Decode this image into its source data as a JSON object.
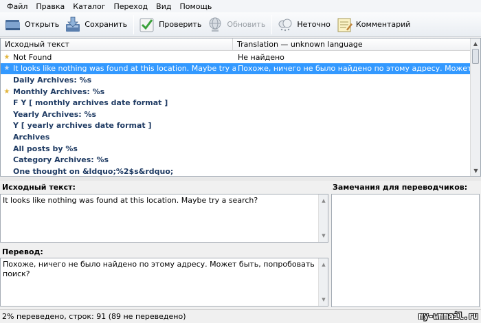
{
  "menu": [
    "Файл",
    "Правка",
    "Каталог",
    "Переход",
    "Вид",
    "Помощь"
  ],
  "toolbar": {
    "open": "Открыть",
    "save": "Сохранить",
    "validate": "Проверить",
    "update": "Обновить",
    "fuzzy": "Неточно",
    "comment": "Комментарий"
  },
  "list": {
    "col_source": "Исходный текст",
    "col_translation": "Translation — unknown language",
    "rows": [
      {
        "source": "Not Found",
        "translation": "Не найдено",
        "mark": "★",
        "state": "translated"
      },
      {
        "source": "It looks like nothing was found at this location. Maybe try a search?",
        "translation": "Похоже, ничего не было найдено по этому адресу. Может быть, п...",
        "mark": "★",
        "state": "selected"
      },
      {
        "source": "Daily Archives: %s",
        "translation": "",
        "mark": "",
        "state": "untranslated"
      },
      {
        "source": "Monthly Archives: %s",
        "translation": "",
        "mark": "★",
        "state": "untranslated"
      },
      {
        "source": "F Y  [ monthly archives date format ]",
        "translation": "",
        "mark": "",
        "state": "untranslated"
      },
      {
        "source": "Yearly Archives: %s",
        "translation": "",
        "mark": "",
        "state": "untranslated"
      },
      {
        "source": "Y  [ yearly archives date format ]",
        "translation": "",
        "mark": "",
        "state": "untranslated"
      },
      {
        "source": "Archives",
        "translation": "",
        "mark": "",
        "state": "untranslated"
      },
      {
        "source": "All posts by %s",
        "translation": "",
        "mark": "",
        "state": "untranslated"
      },
      {
        "source": "Category Archives: %s",
        "translation": "",
        "mark": "",
        "state": "untranslated"
      },
      {
        "source": "One thought on &ldquo;%2$s&rdquo;",
        "translation": "",
        "mark": "",
        "state": "untranslated"
      }
    ]
  },
  "editor": {
    "source_label": "Исходный текст:",
    "source_text": "It looks like nothing was found at this location. Maybe try a search?",
    "translation_label": "Перевод:",
    "translation_text": "Похоже, ничего не было найдено по этому адресу. Может быть, попробовать поиск?",
    "notes_label": "Замечания для переводчиков:"
  },
  "status": "2% переведено, строк: 91 (89 не переведено)",
  "watermark": "my-wmmail.ru",
  "colors": {
    "selection": "#3399ff",
    "untranslated_text": "#1f3b63",
    "star": "#e2b43a"
  }
}
